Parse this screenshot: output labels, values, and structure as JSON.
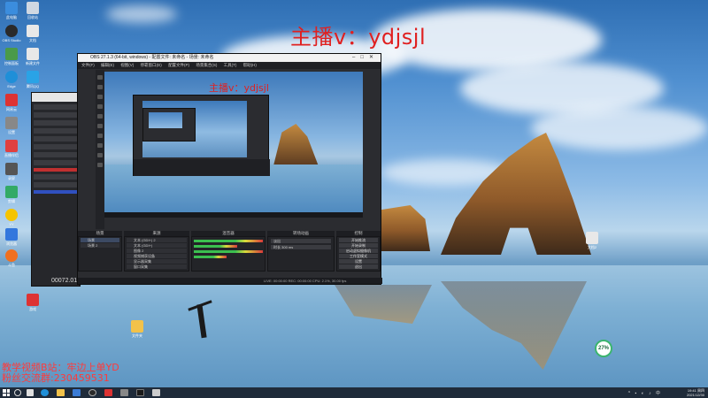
{
  "overlay": {
    "host_watermark": "主播v：ydjsjl",
    "caption_line1": "教学视频B站：牢边上单YD",
    "caption_line2": "粉丝交流群:230459531",
    "clock_widget_value": "27%"
  },
  "desktop_icons": [
    {
      "label": "此电脑",
      "color": "#3b8dde"
    },
    {
      "label": "回收站",
      "color": "#d0d8e2"
    },
    {
      "label": "OBS Studio",
      "color": "#2a2a2a"
    },
    {
      "label": "文档",
      "color": "#e8e8e8"
    },
    {
      "label": "控制面板",
      "color": "#4a9a4a"
    },
    {
      "label": "新建文件",
      "color": "#e8e8e8"
    },
    {
      "label": "Edge",
      "color": "#1f8fd8"
    },
    {
      "label": "腾讯QQ",
      "color": "#2aa3e6"
    },
    {
      "label": "网易云",
      "color": "#d33"
    },
    {
      "label": "设置",
      "color": "#888"
    },
    {
      "label": "直播伴侣",
      "color": "#e04040"
    },
    {
      "label": "录屏",
      "color": "#555"
    },
    {
      "label": "剪辑",
      "color": "#3a6"
    },
    {
      "label": "YY",
      "color": "#f5c400"
    },
    {
      "label": "浏览器",
      "color": "#3377dd"
    },
    {
      "label": "斗鱼",
      "color": "#f07020"
    },
    {
      "label": "游戏",
      "color": "#111"
    },
    {
      "label": "文件夹",
      "color": "#f2c24a"
    },
    {
      "label": "文档2",
      "color": "#e8e8e8"
    }
  ],
  "obs_window": {
    "title": "OBS 27.1.3 (64-bit, windows) - 配置文件: 未命名 - 场景: 未命名",
    "menu": [
      "文件(F)",
      "编辑(E)",
      "视图(V)",
      "停靠窗口(D)",
      "配置文件(P)",
      "场景集合(S)",
      "工具(T)",
      "帮助(H)"
    ],
    "preview_watermark": "主播v：ydjsjl",
    "docks": {
      "scenes_header": "场景",
      "sources_header": "来源",
      "mixer_header": "混音器",
      "transitions_header": "转场动画",
      "controls_header": "控制",
      "scenes": [
        "场景",
        "场景 2"
      ],
      "sources": [
        "文本 (GDI+) 2",
        "文本 (GDI+)",
        "图像 2",
        "视频捕获设备",
        "显示器采集",
        "窗口采集",
        "媒体源"
      ],
      "controls": [
        "开始推流",
        "开始录制",
        "启动虚拟摄像机",
        "工作室模式",
        "设置",
        "退出"
      ],
      "transition_value": "淡出",
      "duration_label": "时长",
      "duration_value": "300 ms"
    },
    "statusbar": "LIVE: 00:00:00   REC: 00:00:00   CPU: 2.1%, 30.00 fps"
  },
  "back_window": {
    "timer": "00072.01"
  },
  "taskbar": {
    "apps": [
      {
        "name": "task-view",
        "color": "#e0e0e0"
      },
      {
        "name": "edge",
        "color": "#1f8fd8"
      },
      {
        "name": "file-explorer",
        "color": "#f2c24a"
      },
      {
        "name": "store",
        "color": "#3a7bd5"
      },
      {
        "name": "obs",
        "color": "#2a2a2a"
      },
      {
        "name": "media",
        "color": "#d33"
      },
      {
        "name": "app7",
        "color": "#888"
      },
      {
        "name": "app8",
        "color": "#1a1a1a"
      }
    ],
    "time": "19:41 周四",
    "date": "2021/12/30"
  }
}
